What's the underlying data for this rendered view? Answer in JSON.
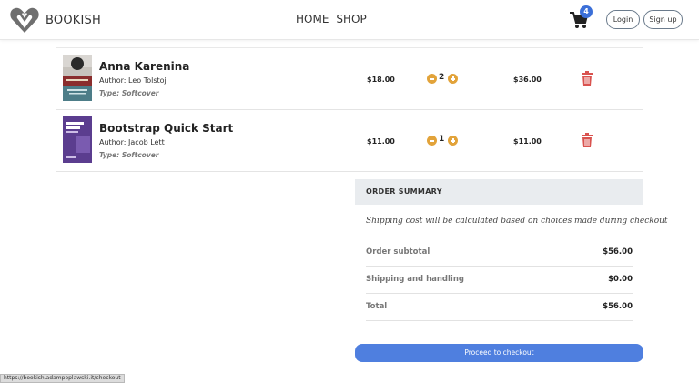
{
  "header": {
    "brand": "BOOKISH",
    "nav": [
      "HOME",
      "SHOP"
    ],
    "cart_count": "4",
    "login_label": "Login",
    "signup_label": "Sign up",
    "cart_icon": "shopping-cart-icon"
  },
  "items": [
    {
      "title": "Anna Karenina",
      "author": "Author: Leo Tolstoj",
      "type": "Type: Softcover",
      "price": "$18.00",
      "quantity": "2",
      "total": "$36.00"
    },
    {
      "title": "Bootstrap Quick Start",
      "author": "Author: Jacob Lett",
      "type": "Type: Softcover",
      "price": "$11.00",
      "quantity": "1",
      "total": "$11.00"
    }
  ],
  "summary": {
    "heading": "ORDER SUMMARY",
    "note": "Shipping cost will be calculated based on choices made during checkout",
    "rows": [
      {
        "label": "Order subtotal",
        "value": "$56.00"
      },
      {
        "label": "Shipping and handling",
        "value": "$0.00"
      },
      {
        "label": "Total",
        "value": "$56.00"
      }
    ],
    "checkout_label": "Proceed to checkout"
  },
  "status_url": "https://bookish.adampoplawski.it/checkout",
  "colors": {
    "accent": "#4f7fdf",
    "badge": "#3b6fd8",
    "qty_button": "#e2a33a",
    "trash": "#d9534f"
  }
}
